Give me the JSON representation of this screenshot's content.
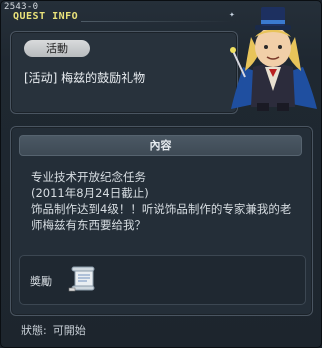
{
  "window": {
    "quest_id": "2543-0",
    "title": "QUEST INFO"
  },
  "quest": {
    "category_tag": "活動",
    "name": "[活动] 梅兹的鼓励礼物"
  },
  "content": {
    "header": "內容",
    "lines": [
      "专业技术开放纪念任务",
      "(2011年8月24日截止)",
      "饰品制作达到4级！！听说饰品制作的专家兼我的老",
      "师梅兹有东西要给我？"
    ]
  },
  "reward": {
    "label": "奬勵",
    "icon": "scroll-icon"
  },
  "status": {
    "label": "狀態:",
    "value": "可開始"
  },
  "colors": {
    "title": "#e9e27a",
    "panel_border": "#4a5561",
    "background": "#1f2831"
  }
}
